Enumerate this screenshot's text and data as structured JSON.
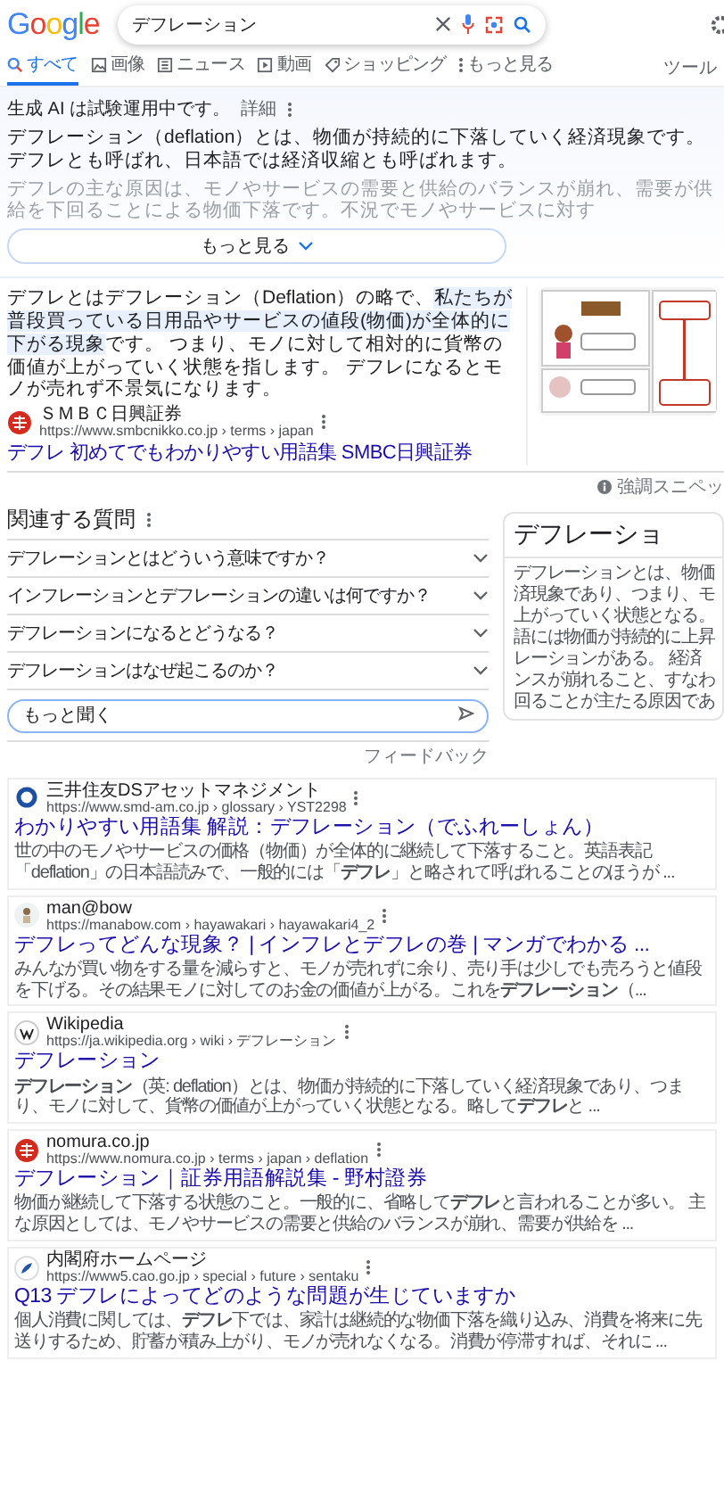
{
  "header": {
    "logo": "Google",
    "query": "デフレーション"
  },
  "tabs": [
    {
      "label": "すべて",
      "selected": true
    },
    {
      "label": "画像",
      "selected": false
    },
    {
      "label": "ニュース",
      "selected": false
    },
    {
      "label": "動画",
      "selected": false
    },
    {
      "label": "ショッピング",
      "selected": false
    },
    {
      "label": "もっと見る",
      "selected": false
    }
  ],
  "tools": "ツール",
  "ai_overview": {
    "notice": "生成 AI は試験運用中です。",
    "details_link": "詳細",
    "paragraphs": [
      {
        "text": "デフレーション（deflation）とは、物価が持続的に下落していく経済現象です。デフレとも呼ばれ、日本語では経済収縮とも呼ばれます。",
        "faded": false
      },
      {
        "text": "デフレの主な原因は、モノやサービスの需要と供給のバランスが崩れ、需要が供給を下回ることによる物価下落です。不況でモノやサービスに対す",
        "faded": true
      }
    ],
    "more_button": "もっと見る"
  },
  "featured_snippet": {
    "text_before": "デフレとはデフレーション（Deflation）の略で、",
    "text_highlighted": "私たちが普段買っている日用品やサービスの値段(物価)が全体的に下がる現象",
    "text_after": "です。 つまり、モノに対して相対的に貨幣の価値が上がっていく状態を指します。 デフレになるとモノが売れず不景気になります。",
    "source": {
      "name": "ＳＭＢＣ日興証券",
      "url": "https://www.smbcnikko.co.jp › terms › japan"
    },
    "link": "デフレ 初めてでもわかりやすい用語集 SMBC日興証券",
    "footer_label": "強調スニペッ"
  },
  "related_questions": {
    "title": "関連する質問",
    "questions": [
      {
        "text": "デフレーションとはどういう意味ですか？",
        "expanded": false
      },
      {
        "text": "インフレーションとデフレーションの違いは何ですか？",
        "expanded": false
      },
      {
        "text": "デフレーションになるとどうなる？",
        "expanded": false
      },
      {
        "text": "デフレーションはなぜ起こるのか？",
        "expanded": false
      }
    ],
    "ask_placeholder": "もっと聞く",
    "feedback": "フィードバック"
  },
  "knowledge_panel": {
    "title": "デフレーショ",
    "lines": [
      "デフレーションとは、物価",
      "済現象であり、つまり、モ",
      "上がっていく状態となる。",
      "語には物価が持続的に上昇",
      "レーションがある。 経済",
      "ンスが崩れること、すなわ",
      "回ることが主たる原因であ"
    ]
  },
  "results": [
    {
      "site": "三井住友DSアセットマネジメント",
      "url": "https://www.smd-am.co.jp › glossary › YST2298",
      "title": "わかりやすい用語集 解説：デフレーション（でふれーしょん）",
      "snippet": "世の中のモノやサービスの価格（物価）が全体的に継続して下落すること。英語表記「deflation」の日本語読みで、一般的には「**デフレ**」と略されて呼ばれることのほうが ..."
    },
    {
      "site": "man@bow",
      "url": "https://manabow.com › hayawakari › hayawakari4_2",
      "title": "デフレってどんな現象？ | インフレとデフレの巻 | マンガでわかる ...",
      "snippet": "みんなが買い物をする量を減らすと、モノが売れずに余り、売り手は少しでも売ろうと値段を下げる。その結果モノに対してのお金の価値が上がる。これを**デフレーション**（..."
    },
    {
      "site": "Wikipedia",
      "url": "https://ja.wikipedia.org › wiki › デフレーション",
      "title": "デフレーション",
      "snippet": "**デフレーション**（英: deflation）とは、物価が持続的に下落していく経済現象であり、つまり、モノに対して、貨幣の価値が上がっていく状態となる。略して**デフレ**と ..."
    },
    {
      "site": "nomura.co.jp",
      "url": "https://www.nomura.co.jp › terms › japan › deflation",
      "title": "デフレーション｜証券用語解説集 - 野村證券",
      "snippet": "物価が継続して下落する状態のこと。一般的に、省略して**デフレ**と言われることが多い。 主な原因としては、モノやサービスの需要と供給のバランスが崩れ、需要が供給を ..."
    },
    {
      "site": "内閣府ホームページ",
      "url": "https://www5.cao.go.jp › special › future › sentaku",
      "title": "Q13 デフレによってどのような問題が生じていますか",
      "snippet": "個人消費に関しては、**デフレ**下では、家計は継続的な物価下落を織り込み、消費を将来に先送りするため、貯蓄が積み上がり、モノが売れなくなる。消費が停滞すれば、それに ..."
    }
  ]
}
